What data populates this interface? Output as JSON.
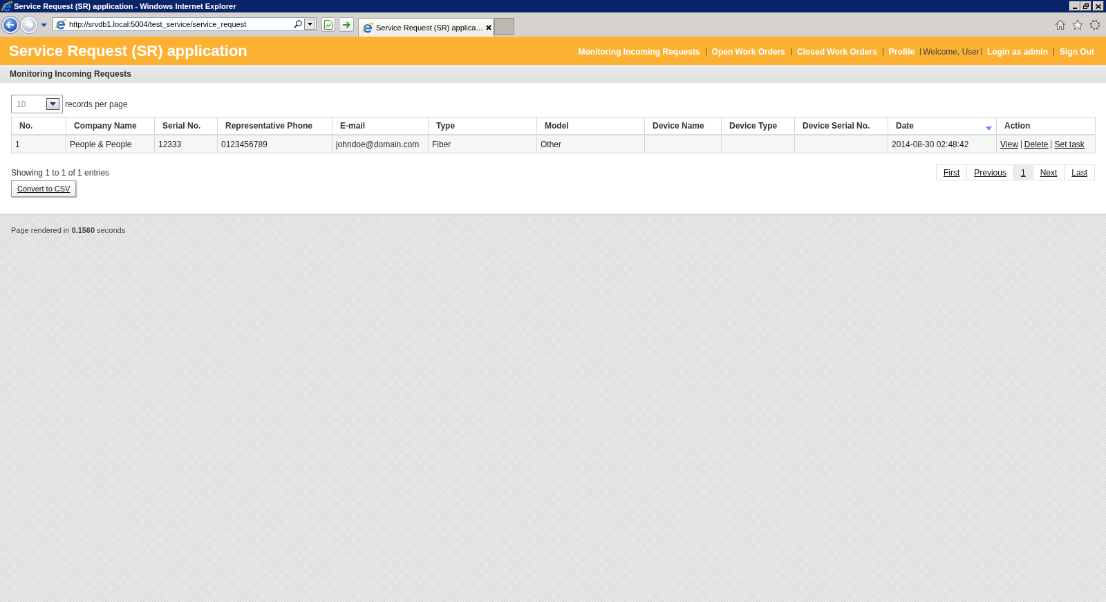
{
  "window": {
    "title": "Service Request (SR) application - Windows Internet Explorer"
  },
  "browser": {
    "address": "http://srvdb1.local:5004/test_service/service_request",
    "tabs": [
      {
        "label": "Service Request (SR) applica…",
        "selected": true
      }
    ]
  },
  "header": {
    "title": "Service Request (SR) application",
    "nav": [
      {
        "label": "Monitoring Incoming Requests",
        "kind": "link"
      },
      {
        "label": "Open Work Orders",
        "kind": "link"
      },
      {
        "label": "Closed Work Orders",
        "kind": "link"
      },
      {
        "label": "Profile",
        "kind": "link"
      },
      {
        "label": "Welcome, User",
        "kind": "text"
      },
      {
        "label": "Login as admin",
        "kind": "link"
      },
      {
        "label": "Sign Out",
        "kind": "link"
      }
    ]
  },
  "subheader": {
    "title": "Monitoring Incoming Requests"
  },
  "page_length": {
    "value": "10",
    "label": "records per page"
  },
  "table": {
    "columns": [
      {
        "label": "No.",
        "sorted": false
      },
      {
        "label": "Company Name",
        "sorted": false
      },
      {
        "label": "Serial No.",
        "sorted": false
      },
      {
        "label": "Representative Phone",
        "sorted": false
      },
      {
        "label": "E-mail",
        "sorted": false
      },
      {
        "label": "Type",
        "sorted": false
      },
      {
        "label": "Model",
        "sorted": false
      },
      {
        "label": "Device Name",
        "sorted": false
      },
      {
        "label": "Device Type",
        "sorted": false
      },
      {
        "label": "Device Serial No.",
        "sorted": false
      },
      {
        "label": "Date",
        "sorted": true
      },
      {
        "label": "Action",
        "sorted": false
      }
    ],
    "rows": [
      {
        "cells": [
          "1",
          "People & People",
          "12333",
          "0123456789",
          "johndoe@domain.com",
          "Fiber",
          "Other",
          null,
          null,
          null,
          "2014-08-30 02:48:42"
        ],
        "actions": [
          "View",
          "Delete",
          "Set task"
        ]
      }
    ]
  },
  "info": "Showing 1 to 1 of 1 entries",
  "export_button": "Convert to CSV",
  "pagination": [
    {
      "label": "First",
      "selected": false
    },
    {
      "label": "Previous",
      "selected": false
    },
    {
      "label": "1",
      "selected": true
    },
    {
      "label": "Next",
      "selected": false
    },
    {
      "label": "Last",
      "selected": false
    }
  ],
  "footer": {
    "text": "Page rendered in **0.1560** seconds"
  }
}
